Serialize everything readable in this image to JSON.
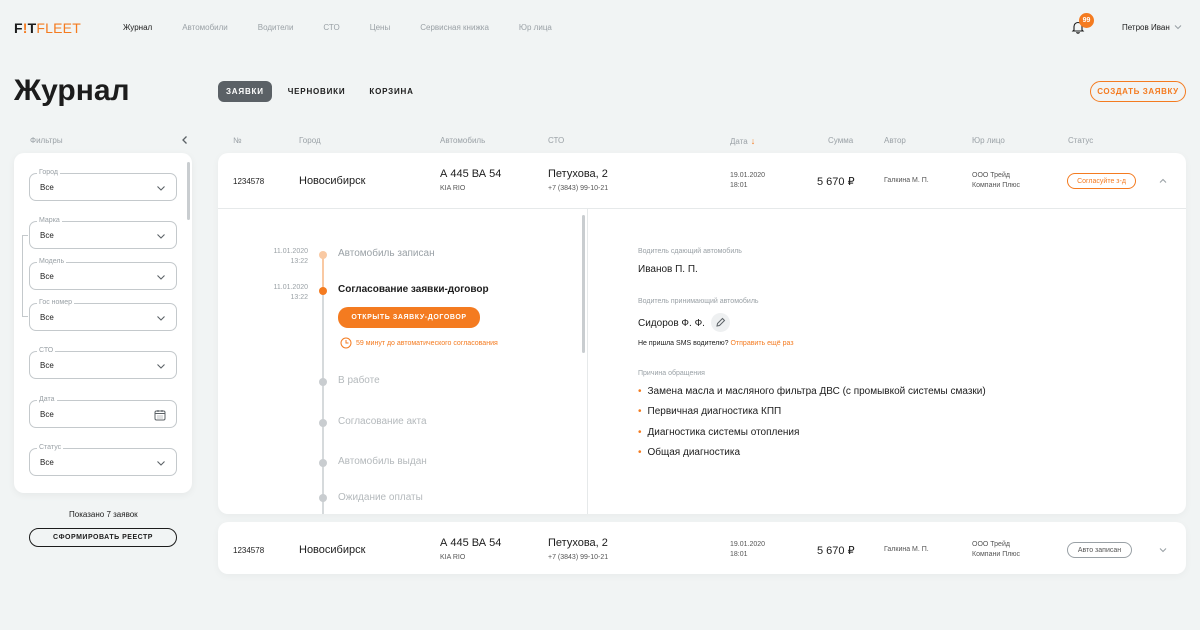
{
  "app": {
    "logo_main": "F",
    "logo_dot": "!",
    "logo_t": "T",
    "logo_fleet": "FLEET"
  },
  "nav": {
    "items": [
      {
        "label": "Журнал"
      },
      {
        "label": "Автомобили"
      },
      {
        "label": "Водители"
      },
      {
        "label": "СТО"
      },
      {
        "label": "Цены"
      },
      {
        "label": "Сервисная книжка"
      },
      {
        "label": "Юр лица"
      }
    ],
    "active_index": 0,
    "notifications_count": "99",
    "user_name": "Петров Иван"
  },
  "header": {
    "title": "Журнал",
    "tabs": [
      {
        "label": "ЗАЯВКИ"
      },
      {
        "label": "ЧЕРНОВИКИ"
      },
      {
        "label": "КОРЗИНА"
      }
    ],
    "active_tab": 0,
    "create_button": "СОЗДАТЬ ЗАЯВКУ"
  },
  "filters": {
    "label": "Фильтры",
    "fields": [
      {
        "label": "Город",
        "value": "Все",
        "icon": "chevron-down-icon"
      },
      {
        "label": "Марка",
        "value": "Все",
        "icon": "chevron-down-icon"
      },
      {
        "label": "Модель",
        "value": "Все",
        "icon": "chevron-down-icon"
      },
      {
        "label": "Гос номер",
        "value": "Все",
        "icon": "chevron-down-icon"
      },
      {
        "label": "СТО",
        "value": "Все",
        "icon": "chevron-down-icon"
      },
      {
        "label": "Дата",
        "value": "Все",
        "icon": "calendar-icon"
      },
      {
        "label": "Статус",
        "value": "Все",
        "icon": "chevron-down-icon"
      }
    ],
    "shown_text": "Показано  7 заявок",
    "registry_button": "СФОРМИРОВАТЬ РЕЕСТР"
  },
  "table": {
    "columns": [
      "№",
      "Город",
      "Автомобиль",
      "СТО",
      "Дата",
      "Сумма",
      "Автор",
      "Юр лицо",
      "Статус"
    ],
    "sorted_column": "Дата",
    "rows": [
      {
        "number": "1234578",
        "city": "Новосибирск",
        "car_plate": "А 445 ВА 54",
        "car_model": "KIA RIO",
        "sto_name": "Петухова, 2",
        "sto_phone": "+7 (3843) 99-10-21",
        "date": "19.01.2020",
        "time": "18:01",
        "sum": "5 670 ₽",
        "author": "Галкина М. П.",
        "legal_1": "ООО Трейд",
        "legal_2": "Компани Плюс",
        "status": "Согласуйте з-д",
        "status_color": "#f47b20",
        "expanded": true
      },
      {
        "number": "1234578",
        "city": "Новосибирск",
        "car_plate": "А 445 ВА 54",
        "car_model": "KIA RIO",
        "sto_name": "Петухова, 2",
        "sto_phone": "+7 (3843) 99-10-21",
        "date": "19.01.2020",
        "time": "18:01",
        "sum": "5 670 ₽",
        "author": "Галкина М. П.",
        "legal_1": "ООО Трейд",
        "legal_2": "Компани Плюс",
        "status": "Авто записан",
        "status_color": "#9aa1a6",
        "expanded": false
      }
    ]
  },
  "timeline": {
    "steps": [
      {
        "date": "11.01.2020",
        "time": "13:22",
        "title": "Автомобиль записан",
        "state": "done"
      },
      {
        "date": "11.01.2020",
        "time": "13:22",
        "title": "Согласование заявки-договор",
        "state": "current"
      },
      {
        "date": "",
        "time": "",
        "title": "В работе",
        "state": "todo"
      },
      {
        "date": "",
        "time": "",
        "title": "Согласование акта",
        "state": "todo"
      },
      {
        "date": "",
        "time": "",
        "title": "Автомобиль выдан",
        "state": "todo"
      },
      {
        "date": "",
        "time": "",
        "title": "Ожидание оплаты",
        "state": "todo"
      }
    ],
    "open_button": "ОТКРЫТЬ ЗАЯВКУ-ДОГОВОР",
    "auto_note": "59 минут до автоматического согласования"
  },
  "details": {
    "giver_label": "Водитель сдающий автомобиль",
    "giver_name": "Иванов П. П.",
    "receiver_label": "Водитель принимающий автомобиль",
    "receiver_name": "Сидоров Ф. Ф.",
    "sms_text": "Не пришла SMS водителю?",
    "sms_link": "Отправить ещё раз",
    "reason_label": "Причина обращения",
    "reasons": [
      "Замена масла и масляного фильтра ДВС (с промывкой системы смазки)",
      "Первичная диагностика КПП",
      "Диагностика системы отопления",
      "Общая диагностика"
    ]
  },
  "colors": {
    "accent": "#f47b20",
    "background": "#f1f4f4",
    "card": "#ffffff",
    "muted": "#9aa1a6",
    "tab_active": "#5b6166"
  }
}
